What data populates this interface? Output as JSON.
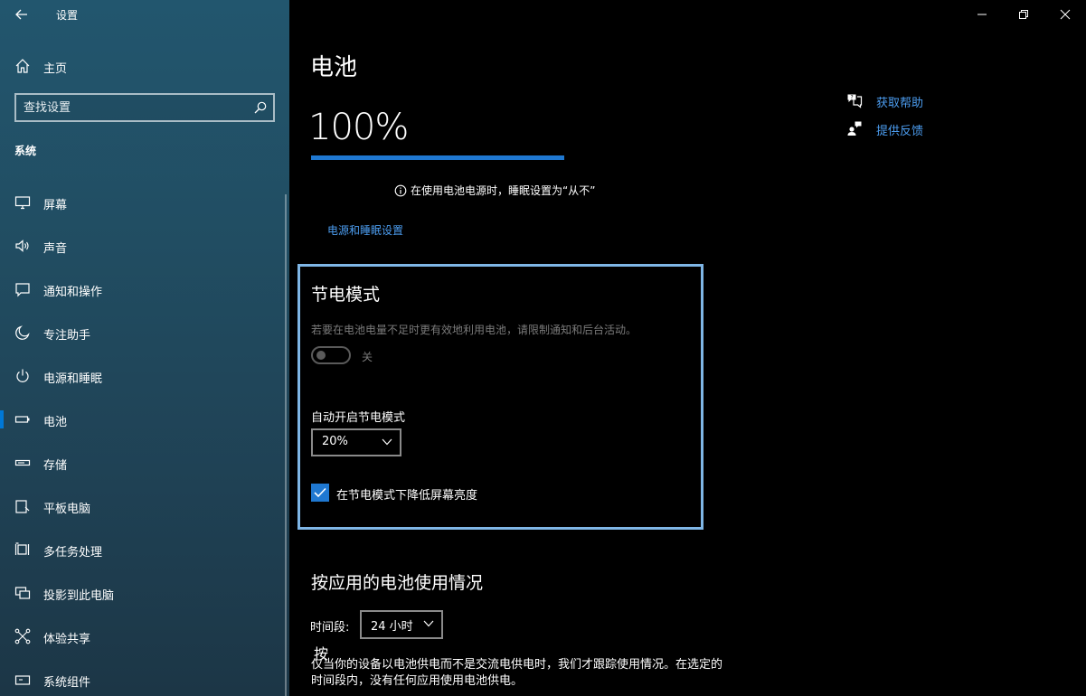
{
  "app": {
    "title": "设置",
    "home_label": "主页",
    "search_placeholder": "查找设置",
    "section": "系统"
  },
  "nav": [
    {
      "label": "屏幕",
      "icon": "monitor-icon"
    },
    {
      "label": "声音",
      "icon": "speaker-icon"
    },
    {
      "label": "通知和操作",
      "icon": "message-icon"
    },
    {
      "label": "专注助手",
      "icon": "moon-icon"
    },
    {
      "label": "电源和睡眠",
      "icon": "power-icon"
    },
    {
      "label": "电池",
      "icon": "battery-icon",
      "selected": true
    },
    {
      "label": "存储",
      "icon": "storage-icon"
    },
    {
      "label": "平板电脑",
      "icon": "tablet-icon"
    },
    {
      "label": "多任务处理",
      "icon": "multitask-icon"
    },
    {
      "label": "投影到此电脑",
      "icon": "project-icon"
    },
    {
      "label": "体验共享",
      "icon": "share-icon"
    },
    {
      "label": "系统组件",
      "icon": "components-icon"
    }
  ],
  "main": {
    "title": "电池",
    "battery_percent_text": "100%",
    "battery_level": 100,
    "sleep_note": "在使用电池电源时，睡眠设置为“从不”",
    "power_sleep_link": "电源和睡眠设置",
    "help_link": "获取帮助",
    "feedback_link": "提供反馈"
  },
  "saver": {
    "title": "节电模式",
    "description": "若要在电池电量不足时更有效地利用电池，请限制通知和后台活动。",
    "toggle_state": "关",
    "auto_label": "自动开启节电模式",
    "auto_value": "20%",
    "checkbox_label": "在节电模式下降低屏幕亮度",
    "checkbox_checked": true
  },
  "usage": {
    "title": "按应用的电池使用情况",
    "period_label": "时间段:",
    "period_value": "24 小时",
    "stray_char": "按",
    "description": "仅当你的设备以电池供电而不是交流电供电时，我们才跟踪使用情况。在选定的时间段内，没有任何应用使用电池供电。"
  },
  "colors": {
    "accent": "#1f78d1",
    "link": "#4c9df0",
    "focus_border": "#7fb6e6",
    "sidebar_top": "#22566e"
  }
}
